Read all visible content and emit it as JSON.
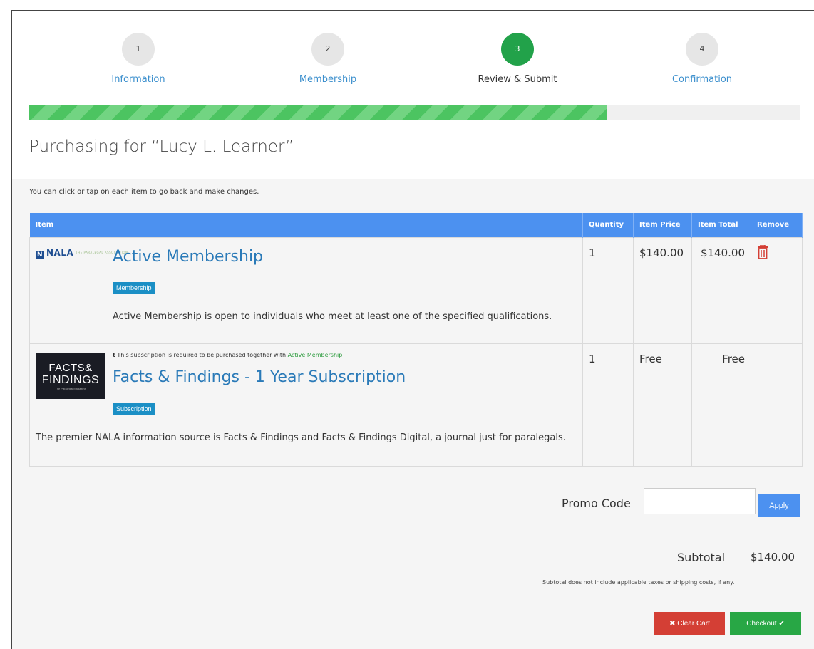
{
  "steps": [
    {
      "number": "1",
      "label": "Information"
    },
    {
      "number": "2",
      "label": "Membership"
    },
    {
      "number": "3",
      "label": "Review & Submit"
    },
    {
      "number": "4",
      "label": "Confirmation"
    }
  ],
  "progress": {
    "percent": 75,
    "color": "#4cc461"
  },
  "purchasing_title": "Purchasing for “Lucy L. Learner”",
  "hint": "You can click or tap on each item to go back and make changes.",
  "table": {
    "headers": [
      "Item",
      "Quantity",
      "Item Price",
      "Item Total",
      "Remove"
    ],
    "rows": [
      {
        "logo_text": "NALA",
        "logo_tag": "THE PARALEGAL ASSOCIATION",
        "title": "Active Membership",
        "badge": "Membership",
        "description": "Active Membership is open to individuals who meet at least one of the specified qualifications.",
        "quantity": "1",
        "price": "$140.00",
        "total": "$140.00",
        "remove_icon": "trash-icon"
      },
      {
        "logo_line1": "FACTS&",
        "logo_line2": "FINDINGS",
        "logo_line3": "The Paralegal Magazine",
        "required_marker": "t",
        "required_note": "This subscription is required to be purchased together with",
        "required_link": "Active Membership",
        "title": "Facts & Findings - 1 Year Subscription",
        "badge": "Subscription",
        "description": "The premier NALA information source is Facts & Findings and Facts & Findings Digital, a journal just for paralegals.",
        "quantity": "1",
        "price": "Free",
        "total": "Free"
      }
    ]
  },
  "promo": {
    "label": "Promo Code",
    "value": "",
    "button": "Apply"
  },
  "subtotal": {
    "label": "Subtotal",
    "value": "$140.00",
    "note": "Subtotal does not include applicable taxes or shipping costs, if any."
  },
  "buttons": {
    "clear": "✖ Clear Cart",
    "checkout": "Checkout ✔"
  },
  "colors": {
    "accent": "#4c91f0",
    "success": "#28a745",
    "danger": "#d43f35",
    "link": "#2a7ab8"
  }
}
